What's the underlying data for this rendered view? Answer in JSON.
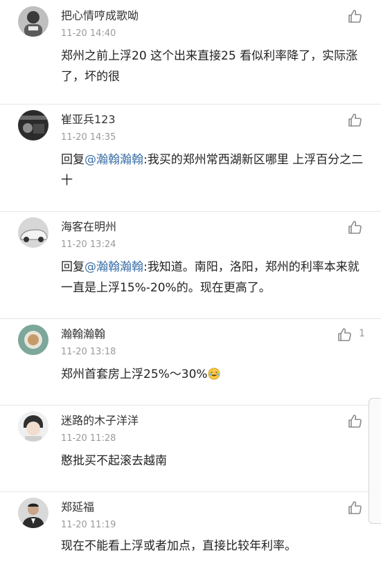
{
  "comments": [
    {
      "name": "把心情哼成歌呦",
      "time": "11-20 14:40",
      "text": "郑州之前上浮20 这个出来直接25 看似利率降了，实际涨了，坏的很",
      "likes": ""
    },
    {
      "name": "崔亚兵123",
      "time": "11-20 14:35",
      "reply_prefix": "回复",
      "mention": "@瀚翰瀚翰",
      "text": ":我买的郑州常西湖新区哪里 上浮百分之二十",
      "likes": ""
    },
    {
      "name": "海客在明州",
      "time": "11-20 13:24",
      "reply_prefix": "回复",
      "mention": "@瀚翰瀚翰",
      "text": ":我知道。南阳，洛阳，郑州的利率本来就一直是上浮15%-20%的。现在更高了。",
      "likes": ""
    },
    {
      "name": "瀚翰瀚翰",
      "time": "11-20 13:18",
      "text": "郑州首套房上浮25%～30%",
      "likes": "1"
    },
    {
      "name": "迷路的木子洋洋",
      "time": "11-20 11:28",
      "text": "憨批买不起滚去越南",
      "likes": ""
    },
    {
      "name": "郑延福",
      "time": "11-20 11:19",
      "text": "现在不能看上浮或者加点，直接比较年利率。",
      "likes": ""
    }
  ],
  "icons": {
    "like": "thumbs-up-icon",
    "emoji": "laughing-tears-emoji-icon"
  },
  "colors": {
    "mention": "#3a6fa6",
    "time": "#9a9a9a",
    "divider": "#e6e6e6"
  }
}
